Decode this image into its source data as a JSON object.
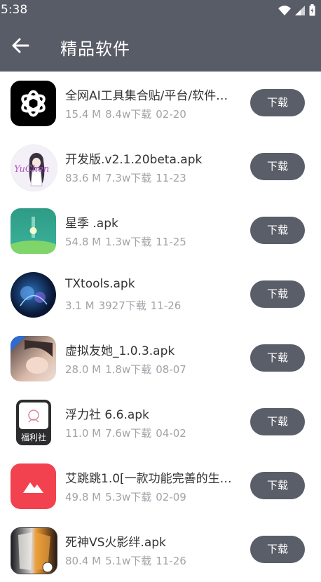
{
  "status_bar": {
    "time": "5:38"
  },
  "header": {
    "title": "精品软件"
  },
  "download_label": "下载",
  "apps": [
    {
      "name": "全网AI工具集合贴/平台/软件…",
      "size": "15.4 M",
      "downloads": "8.4w下载",
      "date": "02-20",
      "icon": "openai-logo-icon"
    },
    {
      "name": "开发版.v2.1.20beta.apk",
      "size": "83.6 M",
      "downloads": "7.3w下载",
      "date": "11-23",
      "icon": "anime-girl-icon",
      "icon_text": "YuChen"
    },
    {
      "name": "星季 .apk",
      "size": "54.8 M",
      "downloads": "1.3w下载",
      "date": "11-25",
      "icon": "green-hill-icon"
    },
    {
      "name": "TXtools.apk",
      "size": "3.1 M",
      "downloads": "3927下载",
      "date": "11-26",
      "icon": "dark-blue-art-icon"
    },
    {
      "name": "虚拟友她_1.0.3.apk",
      "size": "28.0 M",
      "downloads": "1.8w下载",
      "date": "08-07",
      "icon": "sleeping-girl-icon"
    },
    {
      "name": "浮力社 6.6.apk",
      "size": "11.0 M",
      "downloads": "7.6w下载",
      "date": "04-02",
      "icon": "fulishe-icon",
      "icon_text": "福利社"
    },
    {
      "name": "艾跳跳1.0[一款功能完善的生…",
      "size": "49.8 M",
      "downloads": "5.3w下载",
      "date": "02-09",
      "icon": "red-mountain-icon"
    },
    {
      "name": "死神VS火影绊.apk",
      "size": "80.4 M",
      "downloads": "5.1w下载",
      "date": "11-26",
      "icon": "bleach-naruto-icon"
    }
  ]
}
